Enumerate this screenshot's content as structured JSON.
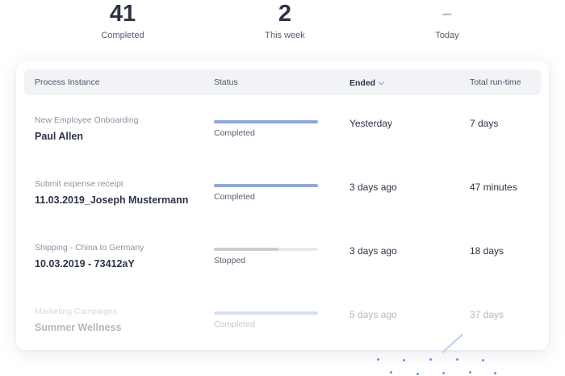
{
  "stats": [
    {
      "value": "41",
      "label": "Completed"
    },
    {
      "value": "2",
      "label": "This week"
    },
    {
      "value": "–",
      "label": "Today"
    }
  ],
  "table": {
    "headers": {
      "process": "Process Instance",
      "status": "Status",
      "ended": "Ended",
      "runtime": "Total run-time"
    },
    "sort_icon": "chevron-down-icon",
    "rows": [
      {
        "category": "New Employee Onboarding",
        "name": "Paul Allen",
        "status": "Completed",
        "progress": 1.0,
        "ended": "Yesterday",
        "runtime": "7 days"
      },
      {
        "category": "Submit expense receipt",
        "name": "11.03.2019_Joseph Mustermann",
        "status": "Completed",
        "progress": 1.0,
        "ended": "3 days ago",
        "runtime": "47 minutes"
      },
      {
        "category": "Shipping - China to Germany",
        "name": "10.03.2019 - 73412aY",
        "status": "Stopped",
        "progress": 0.62,
        "ended": "3 days ago",
        "runtime": "18 days"
      },
      {
        "category": "Marketing Campaigns",
        "name": "Summer Wellness",
        "status": "Completed",
        "progress": 1.0,
        "ended": "5 days ago",
        "runtime": "37 days"
      }
    ]
  },
  "colors": {
    "progress_completed": "#8ea5e6",
    "progress_stopped": "#c9ced6",
    "accent": "#5b7be0"
  }
}
